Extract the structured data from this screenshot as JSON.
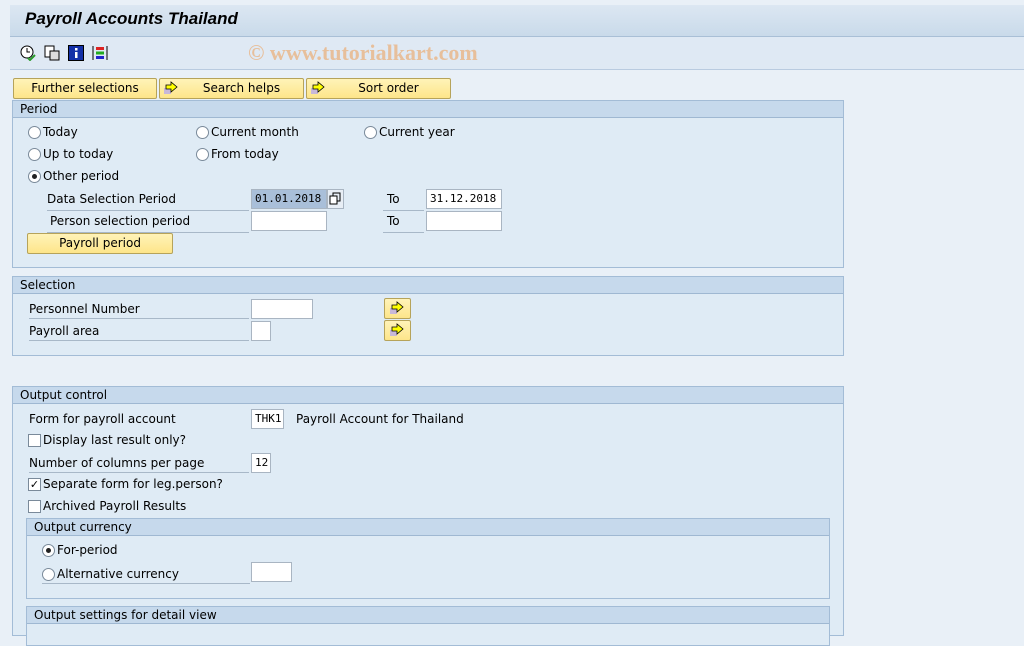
{
  "title": "Payroll Accounts Thailand",
  "watermark": "© www.tutorialkart.com",
  "toolbar": {
    "icons": [
      "execute-clock-icon",
      "copy-variant-icon",
      "info-icon",
      "selection-options-icon"
    ]
  },
  "buttons": {
    "further_selections": "Further selections",
    "search_helps": "Search helps",
    "sort_order": "Sort order"
  },
  "period": {
    "header": "Period",
    "options": [
      "Today",
      "Current month",
      "Current year",
      "Up to today",
      "From today",
      "Other period"
    ],
    "selected": "Other period",
    "data_selection_label": "Data Selection Period",
    "data_from": "01.01.2018",
    "to_label": "To",
    "data_to": "31.12.2018",
    "person_selection_label": "Person selection period",
    "person_from": "",
    "person_to": "",
    "payroll_period_button": "Payroll period"
  },
  "selection": {
    "header": "Selection",
    "personnel_number_label": "Personnel Number",
    "personnel_number": "",
    "payroll_area_label": "Payroll area",
    "payroll_area": ""
  },
  "output": {
    "header": "Output control",
    "form_label": "Form for payroll account",
    "form_value": "THK1",
    "form_desc": "Payroll Account for Thailand",
    "display_last_label": "Display last result only?",
    "display_last": false,
    "columns_label": "Number of columns per page",
    "columns_value": "12",
    "separate_form_label": "Separate form for leg.person?",
    "separate_form": true,
    "archived_label": "Archived Payroll Results",
    "archived": false,
    "currency": {
      "header": "Output currency",
      "for_period": "For-period",
      "alternative": "Alternative currency",
      "selected": "For-period",
      "alt_value": ""
    },
    "detail_header": "Output settings for detail view"
  },
  "colors": {
    "accent_button": "#fde58a",
    "panel_header": "#c6d9ec",
    "panel_body": "#dfebf5"
  }
}
